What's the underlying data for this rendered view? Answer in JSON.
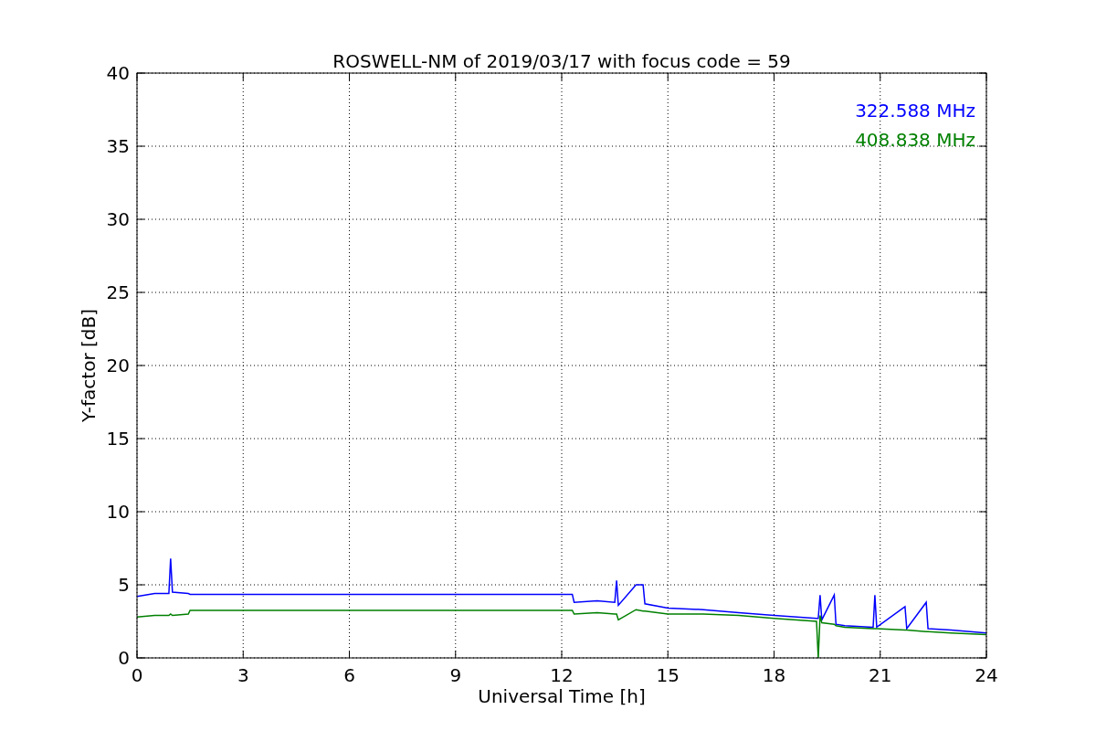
{
  "chart_data": {
    "type": "line",
    "title": "ROSWELL-NM of 2019/03/17 with focus code = 59",
    "xlabel": "Universal Time [h]",
    "ylabel": "Y-factor [dB]",
    "x": [
      0,
      0.5,
      0.9,
      0.95,
      1.0,
      1.45,
      1.5,
      12.3,
      12.35,
      13.0,
      13.5,
      13.55,
      13.6,
      14.1,
      14.3,
      14.35,
      15,
      16,
      17,
      18,
      19.2,
      19.25,
      19.3,
      19.35,
      19.7,
      19.75,
      20,
      20.8,
      20.85,
      20.9,
      21.7,
      21.75,
      22.3,
      22.35,
      23,
      24
    ],
    "series": [
      {
        "name": "322.588 MHz",
        "color": "#0000ff",
        "values": [
          4.2,
          4.4,
          4.4,
          6.8,
          4.5,
          4.4,
          4.35,
          4.35,
          3.8,
          3.9,
          3.8,
          5.3,
          3.6,
          5.0,
          5.0,
          3.7,
          3.4,
          3.3,
          3.1,
          2.9,
          2.7,
          2.7,
          4.3,
          2.6,
          4.3,
          2.3,
          2.2,
          2.1,
          4.3,
          2.1,
          3.5,
          2.0,
          3.8,
          2.0,
          1.9,
          1.7
        ]
      },
      {
        "name": "408.838 MHz",
        "color": "#008000",
        "values": [
          2.8,
          2.9,
          2.9,
          3.0,
          2.9,
          3.0,
          3.25,
          3.25,
          3.0,
          3.1,
          3.0,
          3.0,
          2.6,
          3.3,
          3.2,
          3.2,
          3.0,
          3.0,
          2.9,
          2.7,
          2.5,
          0,
          2.9,
          2.4,
          2.3,
          2.2,
          2.1,
          2.0,
          2.0,
          2.0,
          1.9,
          1.9,
          1.8,
          1.8,
          1.7,
          1.6
        ]
      }
    ],
    "grid": true,
    "xlim": [
      0,
      24
    ],
    "ylim": [
      0,
      40
    ],
    "xticks": [
      0,
      3,
      6,
      9,
      12,
      15,
      18,
      21,
      24
    ],
    "yticks": [
      0,
      5,
      10,
      15,
      20,
      25,
      30,
      35,
      40
    ]
  }
}
